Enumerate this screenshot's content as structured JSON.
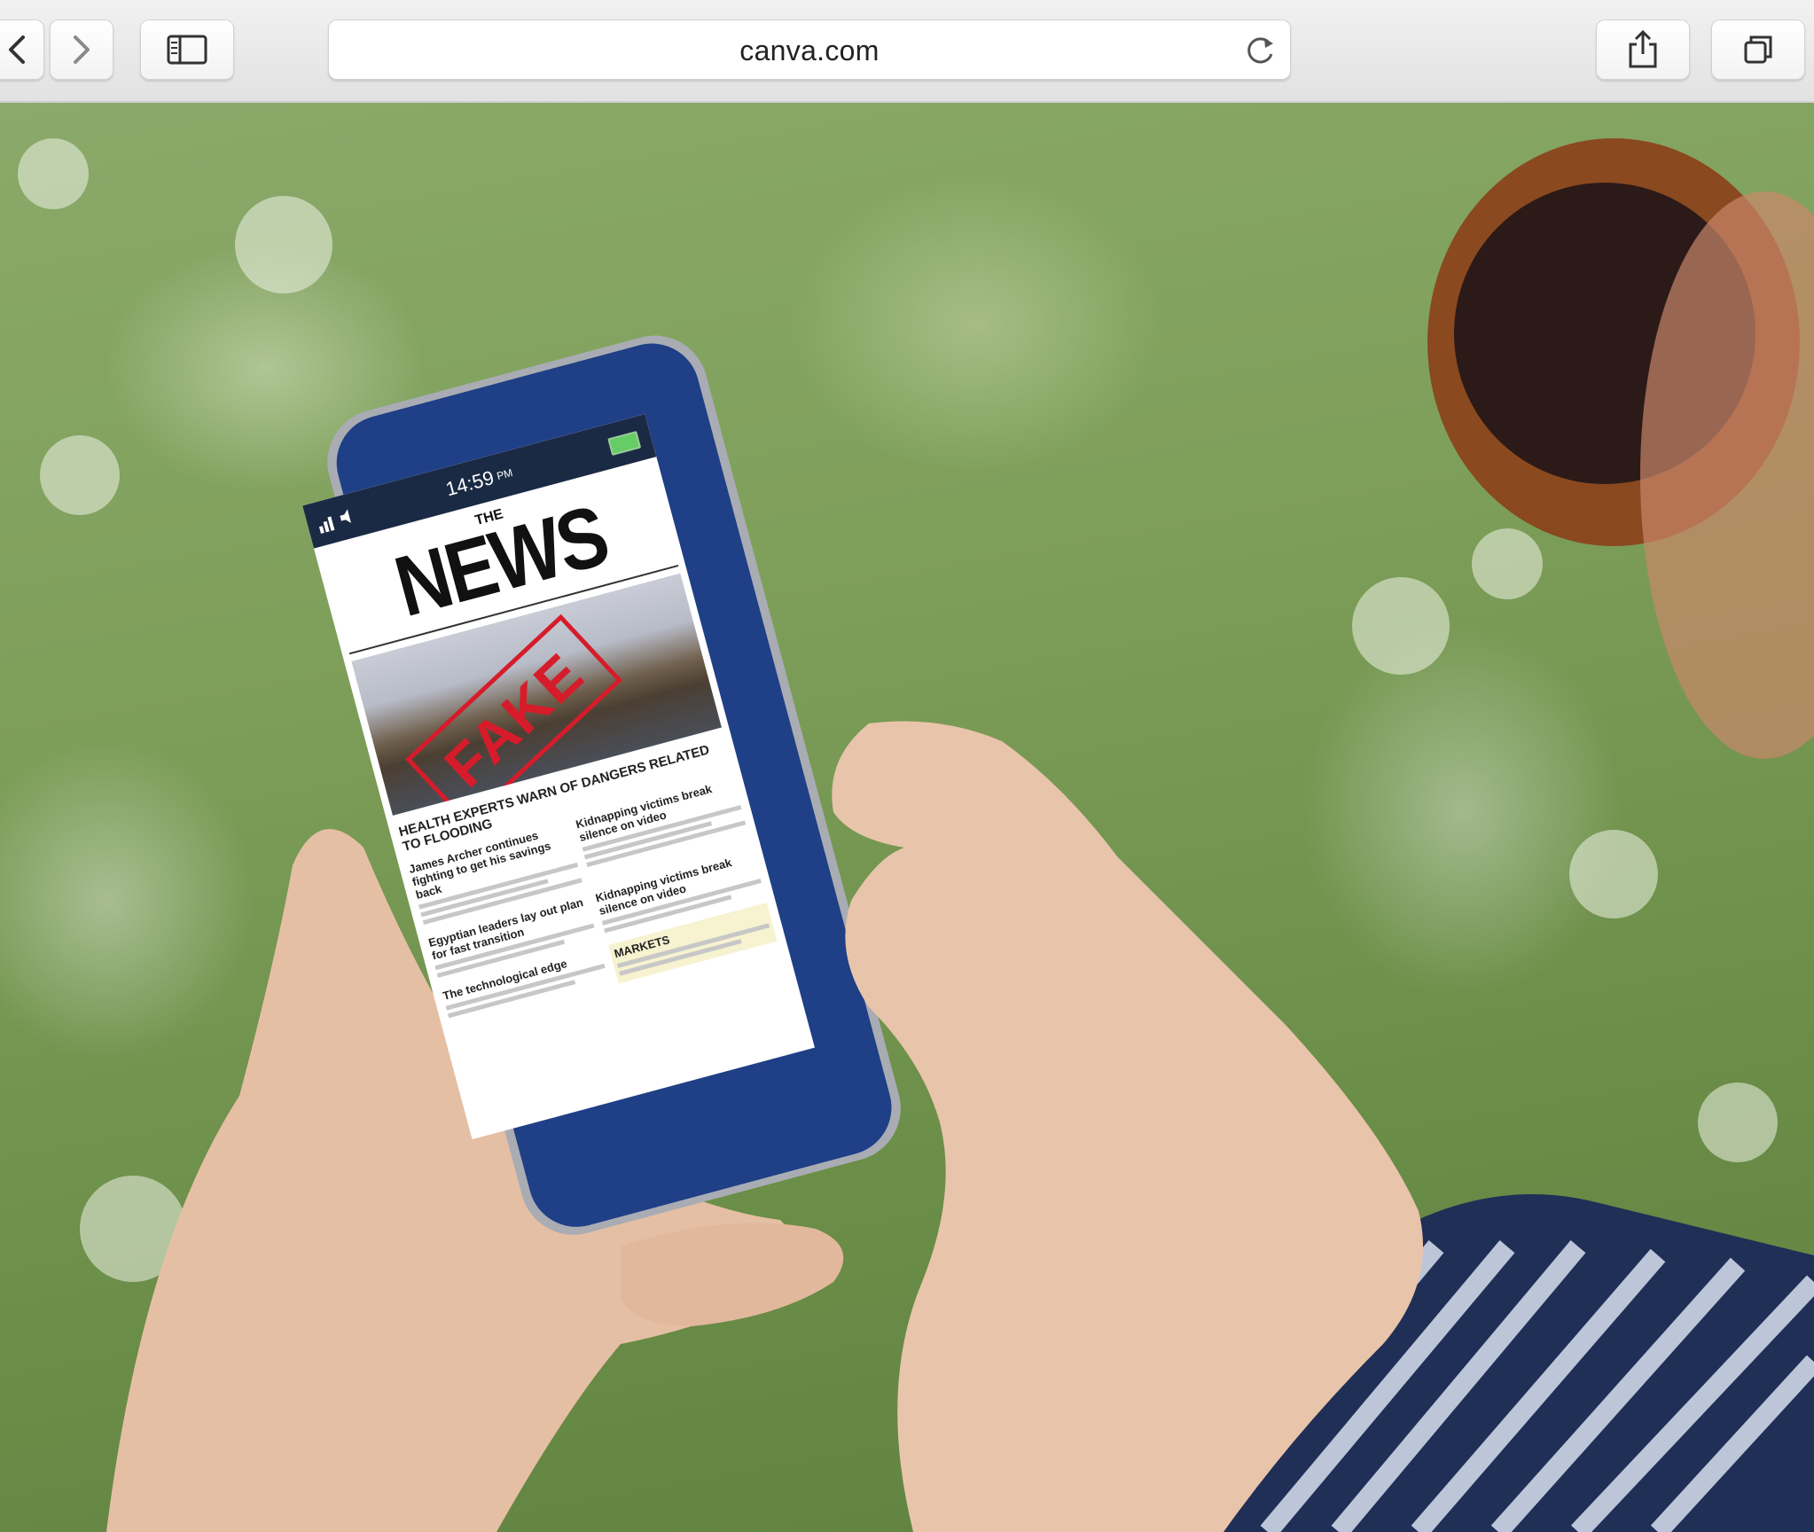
{
  "browser": {
    "url": "canva.com",
    "back_icon": "chevron-left-icon",
    "forward_icon": "chevron-right-icon",
    "sidebar_icon": "sidebar-icon",
    "reload_icon": "reload-icon",
    "share_icon": "share-icon",
    "tabs_icon": "tabs-icon"
  },
  "photo": {
    "phone": {
      "time": "14:59",
      "time_suffix": "PM",
      "masthead_prefix": "THE",
      "masthead": "NEWS",
      "stamp": "FAKE",
      "lead_headline": "HEALTH EXPERTS WARN OF DANGERS RELATED TO FLOODING",
      "articles": [
        "James Archer continues fighting to get his savings back",
        "Kidnapping victims break silence on video",
        "Egyptian leaders lay out plan for fast transition",
        "Kidnapping victims break silence on video",
        "The technological edge",
        "MARKETS"
      ]
    },
    "colors": {
      "phone_body": "#1f3f86",
      "stamp_red": "#d61c2a",
      "foliage": "#7e9f5a"
    }
  }
}
